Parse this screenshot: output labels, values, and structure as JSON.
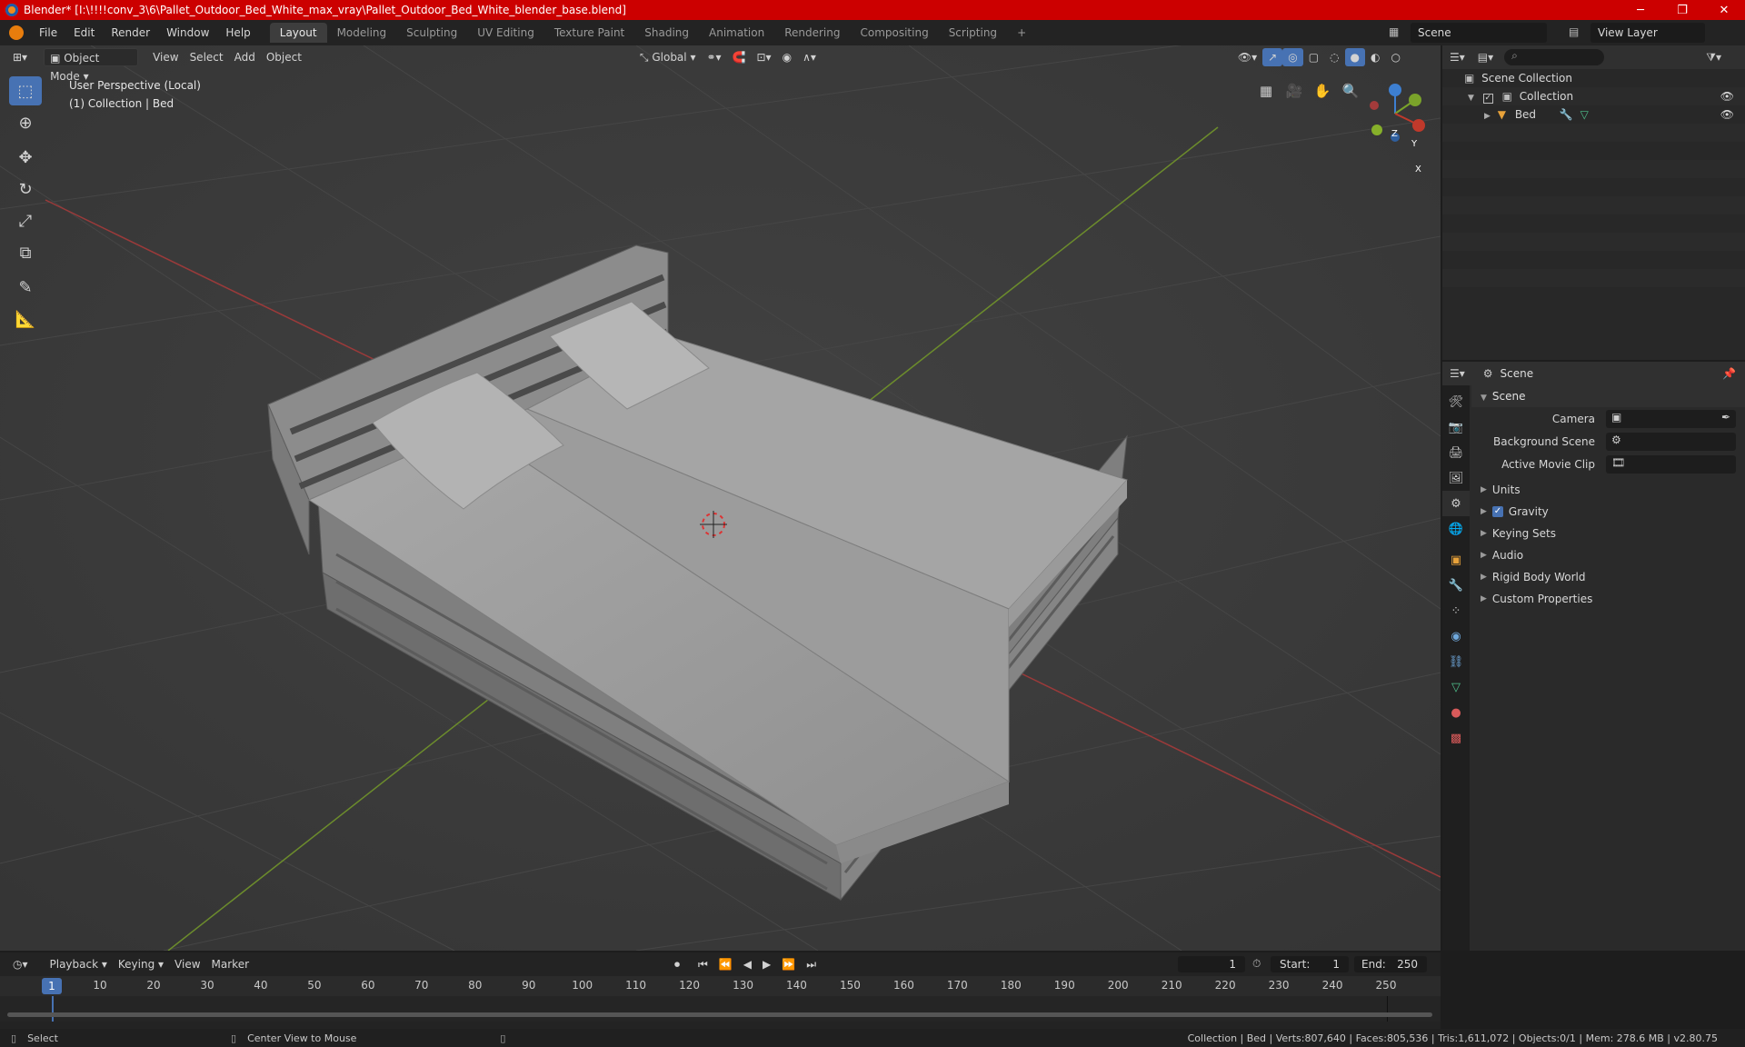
{
  "window": {
    "title": "Blender* [I:\\!!!!conv_3\\6\\Pallet_Outdoor_Bed_White_max_vray\\Pallet_Outdoor_Bed_White_blender_base.blend]",
    "minimize": "─",
    "restore": "❐",
    "close": "✕"
  },
  "menu": {
    "items": [
      "File",
      "Edit",
      "Render",
      "Window",
      "Help"
    ],
    "workspaces": [
      "Layout",
      "Modeling",
      "Sculpting",
      "UV Editing",
      "Texture Paint",
      "Shading",
      "Animation",
      "Rendering",
      "Compositing",
      "Scripting"
    ],
    "active_workspace": "Layout",
    "add_tab": "+",
    "scene": "Scene",
    "view_layer": "View Layer"
  },
  "viewport": {
    "mode": "Object Mode",
    "menus": [
      "View",
      "Select",
      "Add",
      "Object"
    ],
    "orientation": "Global",
    "info_line1": "User Perspective (Local)",
    "info_line2": "(1) Collection | Bed",
    "gizmo": {
      "x": "X",
      "y": "Y",
      "z": "Z"
    }
  },
  "outliner": {
    "root": "Scene Collection",
    "collection": "Collection",
    "object": "Bed"
  },
  "properties": {
    "context": "Scene",
    "panel": "Scene",
    "fields": [
      {
        "label": "Camera"
      },
      {
        "label": "Background Scene"
      },
      {
        "label": "Active Movie Clip"
      }
    ],
    "subpanels": [
      "Units",
      "Gravity",
      "Keying Sets",
      "Audio",
      "Rigid Body World",
      "Custom Properties"
    ],
    "gravity_checked": true
  },
  "timeline": {
    "menus": [
      "Playback",
      "Keying",
      "View",
      "Marker"
    ],
    "current_frame": "1",
    "start_label": "Start:",
    "start": "1",
    "end_label": "End:",
    "end": "250",
    "ticks": [
      "1",
      "10",
      "20",
      "30",
      "40",
      "50",
      "60",
      "70",
      "80",
      "90",
      "100",
      "110",
      "120",
      "130",
      "140",
      "150",
      "160",
      "170",
      "180",
      "190",
      "200",
      "210",
      "220",
      "230",
      "240",
      "250"
    ]
  },
  "status": {
    "select": "Select",
    "center_view": "Center View to Mouse",
    "stats": "Collection | Bed | Verts:807,640 | Faces:805,536 | Tris:1,611,072 | Objects:0/1 | Mem: 278.6 MB | v2.80.75"
  },
  "colors": {
    "accent": "#4772b3",
    "title_bar": "#cc0000",
    "x_axis": "#c0392b",
    "y_axis": "#7aa32a",
    "z_axis": "#3d7fd1"
  }
}
